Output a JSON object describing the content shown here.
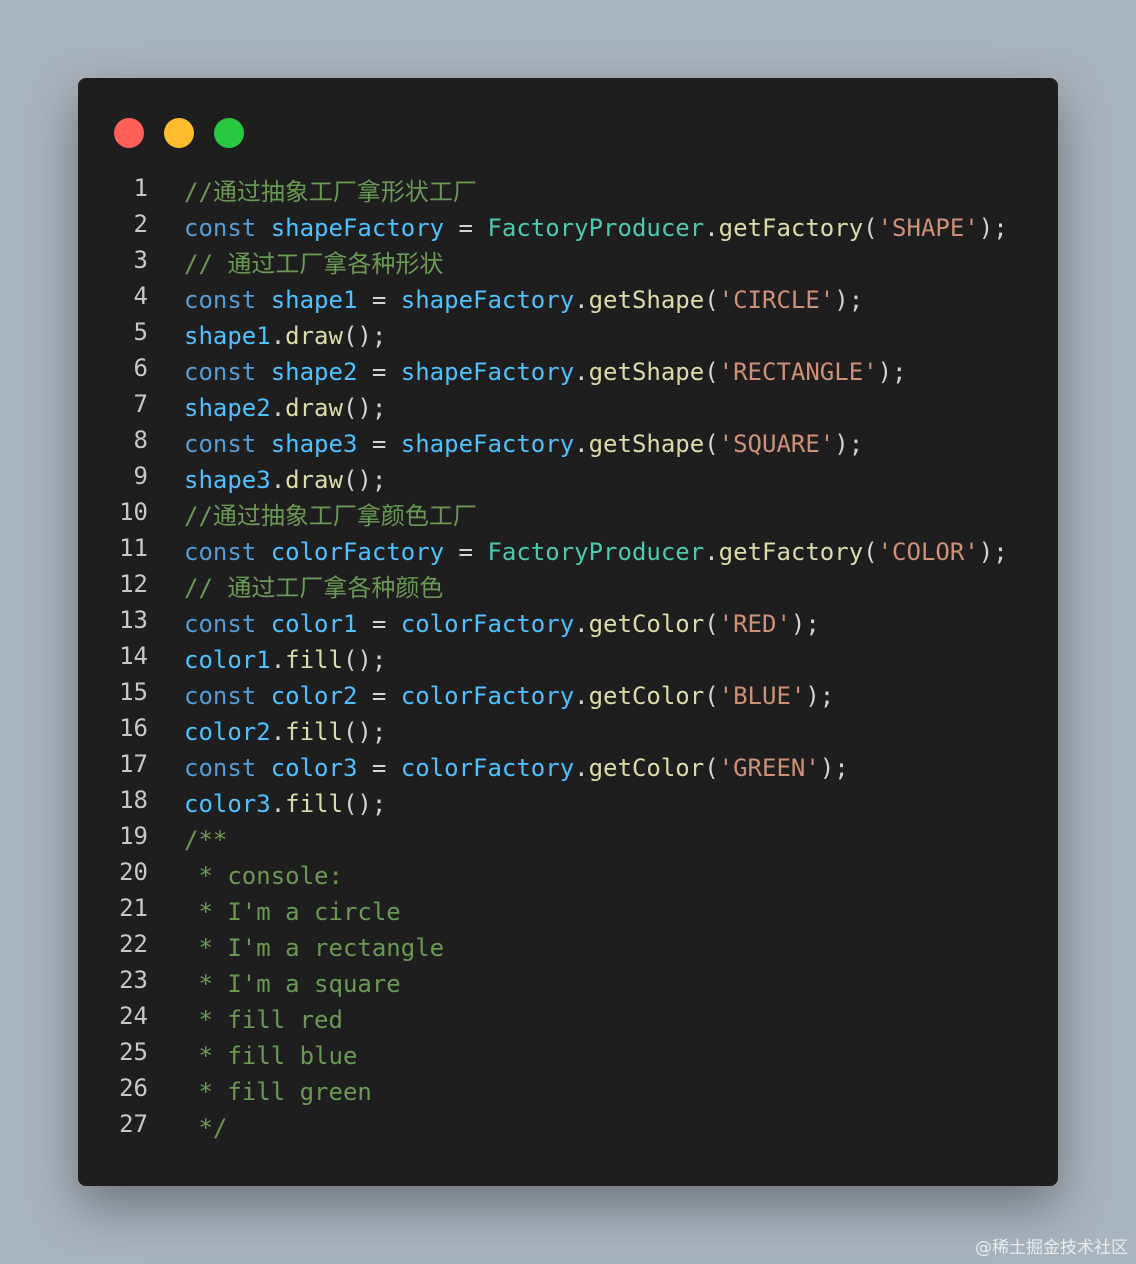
{
  "window": {
    "controls": [
      {
        "name": "close-dot",
        "color": "#ff5f57"
      },
      {
        "name": "minimize-dot",
        "color": "#febc2e"
      },
      {
        "name": "maximize-dot",
        "color": "#28c840"
      }
    ]
  },
  "colors": {
    "keyword": "#569cd6",
    "variable": "#4fc1ff",
    "class": "#4ec9b0",
    "function": "#dcdcaa",
    "string": "#ce9178",
    "comment": "#6a9955",
    "punctuation": "#d4d4d4",
    "line_number": "#c8c8c8",
    "background": "#1e1e1e"
  },
  "code_lines": [
    {
      "num": "1",
      "tokens": [
        {
          "t": "cmt",
          "v": "//通过抽象工厂拿形状工厂"
        }
      ]
    },
    {
      "num": "2",
      "tokens": [
        {
          "t": "kw",
          "v": "const"
        },
        {
          "t": "op",
          "v": " "
        },
        {
          "t": "var",
          "v": "shapeFactory"
        },
        {
          "t": "op",
          "v": " = "
        },
        {
          "t": "cls",
          "v": "FactoryProducer"
        },
        {
          "t": "punct",
          "v": "."
        },
        {
          "t": "fn",
          "v": "getFactory"
        },
        {
          "t": "punct",
          "v": "("
        },
        {
          "t": "str",
          "v": "'SHAPE'"
        },
        {
          "t": "punct",
          "v": ");"
        }
      ]
    },
    {
      "num": "3",
      "tokens": [
        {
          "t": "cmt",
          "v": "// 通过工厂拿各种形状"
        }
      ]
    },
    {
      "num": "4",
      "tokens": [
        {
          "t": "kw",
          "v": "const"
        },
        {
          "t": "op",
          "v": " "
        },
        {
          "t": "var",
          "v": "shape1"
        },
        {
          "t": "op",
          "v": " = "
        },
        {
          "t": "var",
          "v": "shapeFactory"
        },
        {
          "t": "punct",
          "v": "."
        },
        {
          "t": "fn",
          "v": "getShape"
        },
        {
          "t": "punct",
          "v": "("
        },
        {
          "t": "str",
          "v": "'CIRCLE'"
        },
        {
          "t": "punct",
          "v": ");"
        }
      ]
    },
    {
      "num": "5",
      "tokens": [
        {
          "t": "var",
          "v": "shape1"
        },
        {
          "t": "punct",
          "v": "."
        },
        {
          "t": "fn",
          "v": "draw"
        },
        {
          "t": "punct",
          "v": "();"
        }
      ]
    },
    {
      "num": "6",
      "tokens": [
        {
          "t": "kw",
          "v": "const"
        },
        {
          "t": "op",
          "v": " "
        },
        {
          "t": "var",
          "v": "shape2"
        },
        {
          "t": "op",
          "v": " = "
        },
        {
          "t": "var",
          "v": "shapeFactory"
        },
        {
          "t": "punct",
          "v": "."
        },
        {
          "t": "fn",
          "v": "getShape"
        },
        {
          "t": "punct",
          "v": "("
        },
        {
          "t": "str",
          "v": "'RECTANGLE'"
        },
        {
          "t": "punct",
          "v": ");"
        }
      ]
    },
    {
      "num": "7",
      "tokens": [
        {
          "t": "var",
          "v": "shape2"
        },
        {
          "t": "punct",
          "v": "."
        },
        {
          "t": "fn",
          "v": "draw"
        },
        {
          "t": "punct",
          "v": "();"
        }
      ]
    },
    {
      "num": "8",
      "tokens": [
        {
          "t": "kw",
          "v": "const"
        },
        {
          "t": "op",
          "v": " "
        },
        {
          "t": "var",
          "v": "shape3"
        },
        {
          "t": "op",
          "v": " = "
        },
        {
          "t": "var",
          "v": "shapeFactory"
        },
        {
          "t": "punct",
          "v": "."
        },
        {
          "t": "fn",
          "v": "getShape"
        },
        {
          "t": "punct",
          "v": "("
        },
        {
          "t": "str",
          "v": "'SQUARE'"
        },
        {
          "t": "punct",
          "v": ");"
        }
      ]
    },
    {
      "num": "9",
      "tokens": [
        {
          "t": "var",
          "v": "shape3"
        },
        {
          "t": "punct",
          "v": "."
        },
        {
          "t": "fn",
          "v": "draw"
        },
        {
          "t": "punct",
          "v": "();"
        }
      ]
    },
    {
      "num": "10",
      "tokens": [
        {
          "t": "cmt",
          "v": "//通过抽象工厂拿颜色工厂"
        }
      ]
    },
    {
      "num": "11",
      "tokens": [
        {
          "t": "kw",
          "v": "const"
        },
        {
          "t": "op",
          "v": " "
        },
        {
          "t": "var",
          "v": "colorFactory"
        },
        {
          "t": "op",
          "v": " = "
        },
        {
          "t": "cls",
          "v": "FactoryProducer"
        },
        {
          "t": "punct",
          "v": "."
        },
        {
          "t": "fn",
          "v": "getFactory"
        },
        {
          "t": "punct",
          "v": "("
        },
        {
          "t": "str",
          "v": "'COLOR'"
        },
        {
          "t": "punct",
          "v": ");"
        }
      ]
    },
    {
      "num": "12",
      "tokens": [
        {
          "t": "cmt",
          "v": "// 通过工厂拿各种颜色"
        }
      ]
    },
    {
      "num": "13",
      "tokens": [
        {
          "t": "kw",
          "v": "const"
        },
        {
          "t": "op",
          "v": " "
        },
        {
          "t": "var",
          "v": "color1"
        },
        {
          "t": "op",
          "v": " = "
        },
        {
          "t": "var",
          "v": "colorFactory"
        },
        {
          "t": "punct",
          "v": "."
        },
        {
          "t": "fn",
          "v": "getColor"
        },
        {
          "t": "punct",
          "v": "("
        },
        {
          "t": "str",
          "v": "'RED'"
        },
        {
          "t": "punct",
          "v": ");"
        }
      ]
    },
    {
      "num": "14",
      "tokens": [
        {
          "t": "var",
          "v": "color1"
        },
        {
          "t": "punct",
          "v": "."
        },
        {
          "t": "fn",
          "v": "fill"
        },
        {
          "t": "punct",
          "v": "();"
        }
      ]
    },
    {
      "num": "15",
      "tokens": [
        {
          "t": "kw",
          "v": "const"
        },
        {
          "t": "op",
          "v": " "
        },
        {
          "t": "var",
          "v": "color2"
        },
        {
          "t": "op",
          "v": " = "
        },
        {
          "t": "var",
          "v": "colorFactory"
        },
        {
          "t": "punct",
          "v": "."
        },
        {
          "t": "fn",
          "v": "getColor"
        },
        {
          "t": "punct",
          "v": "("
        },
        {
          "t": "str",
          "v": "'BLUE'"
        },
        {
          "t": "punct",
          "v": ");"
        }
      ]
    },
    {
      "num": "16",
      "tokens": [
        {
          "t": "var",
          "v": "color2"
        },
        {
          "t": "punct",
          "v": "."
        },
        {
          "t": "fn",
          "v": "fill"
        },
        {
          "t": "punct",
          "v": "();"
        }
      ]
    },
    {
      "num": "17",
      "tokens": [
        {
          "t": "kw",
          "v": "const"
        },
        {
          "t": "op",
          "v": " "
        },
        {
          "t": "var",
          "v": "color3"
        },
        {
          "t": "op",
          "v": " = "
        },
        {
          "t": "var",
          "v": "colorFactory"
        },
        {
          "t": "punct",
          "v": "."
        },
        {
          "t": "fn",
          "v": "getColor"
        },
        {
          "t": "punct",
          "v": "("
        },
        {
          "t": "str",
          "v": "'GREEN'"
        },
        {
          "t": "punct",
          "v": ");"
        }
      ]
    },
    {
      "num": "18",
      "tokens": [
        {
          "t": "var",
          "v": "color3"
        },
        {
          "t": "punct",
          "v": "."
        },
        {
          "t": "fn",
          "v": "fill"
        },
        {
          "t": "punct",
          "v": "();"
        }
      ]
    },
    {
      "num": "19",
      "tokens": [
        {
          "t": "cmt",
          "v": "/**"
        }
      ]
    },
    {
      "num": "20",
      "tokens": [
        {
          "t": "cmt",
          "v": " * console:"
        }
      ]
    },
    {
      "num": "21",
      "tokens": [
        {
          "t": "cmt",
          "v": " * I'm a circle"
        }
      ]
    },
    {
      "num": "22",
      "tokens": [
        {
          "t": "cmt",
          "v": " * I'm a rectangle"
        }
      ]
    },
    {
      "num": "23",
      "tokens": [
        {
          "t": "cmt",
          "v": " * I'm a square"
        }
      ]
    },
    {
      "num": "24",
      "tokens": [
        {
          "t": "cmt",
          "v": " * fill red"
        }
      ]
    },
    {
      "num": "25",
      "tokens": [
        {
          "t": "cmt",
          "v": " * fill blue"
        }
      ]
    },
    {
      "num": "26",
      "tokens": [
        {
          "t": "cmt",
          "v": " * fill green"
        }
      ]
    },
    {
      "num": "27",
      "tokens": [
        {
          "t": "cmt",
          "v": " */"
        }
      ]
    }
  ],
  "watermark": "@稀土掘金技术社区"
}
